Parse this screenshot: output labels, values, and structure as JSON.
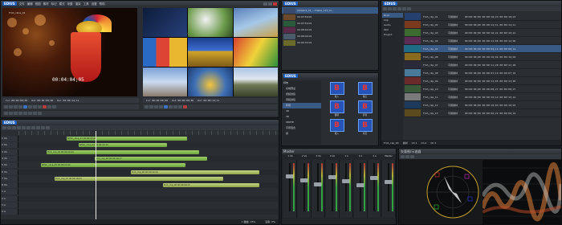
{
  "app": {
    "name": "EDIUS",
    "brand": "#1e5fbf"
  },
  "player": {
    "menu": [
      "文件",
      "编辑",
      "视图",
      "素材",
      "标记",
      "模式",
      "采集",
      "渲染",
      "工具",
      "设置",
      "帮助"
    ],
    "clip_name": "Fmh_cline_01",
    "timecode_overlay": "00:04:04;05",
    "tc_row": [
      "Cur 00:00:00;00",
      "Out 00:00:00;00",
      "Dur 00:00:14;11"
    ]
  },
  "recorder": {
    "tc_row": [
      "Cur 00:00:00;00",
      "Out 00:00:00;00",
      "Dur 00:00:14;11"
    ]
  },
  "bin_top": {
    "rows": [
      "(0)Nab3_01_...Vlabla_123_ld...",
      "00:03:59:05",
      "00:03:59:09",
      "00:08:44:09",
      "00:08:04:09",
      "00:00:32:09"
    ]
  },
  "asset": {
    "title": "EDIUS",
    "tree": [
      "特效",
      "系统预设",
      "视频滤镜",
      "音频滤镜",
      "转场",
      "2D",
      "3D",
      "SMPTE",
      "字幕混合",
      "键"
    ],
    "icons": [
      "推入",
      "推出",
      "翻转",
      "折叠",
      "推入",
      "卷页"
    ]
  },
  "bin_right": {
    "title": "EDIUS",
    "folders": [
      "Root",
      "Clip",
      "Audio",
      "Still",
      "Project"
    ],
    "rows": [
      {
        "name": "Fmh_clip_01",
        "status": "可用素材",
        "tc": "00:00:00;00 00:00:18;23 00:00:18;23"
      },
      {
        "name": "Fmh_clip_02",
        "status": "可用素材",
        "tc": "00:00:00;00 00:00:14;11 00:00:14;11"
      },
      {
        "name": "Fmh_clip_03",
        "status": "可用素材",
        "tc": "00:00:00;00 00:00:10;21 00:00:10;21"
      },
      {
        "name": "Fmh_clip_04",
        "status": "可用素材",
        "tc": "00:00:00;00 00:00:12;06 00:00:12;06"
      },
      {
        "name": "Fmh_clip_05",
        "status": "可用素材",
        "tc": "00:00:00;00 00:00:09;14 00:00:09;14"
      },
      {
        "name": "Fmh_clip_06",
        "status": "可用素材",
        "tc": "00:00:00;00 00:00:16;02 00:00:16;02"
      },
      {
        "name": "Fmh_clip_07",
        "status": "可用素材",
        "tc": "00:00:00;00 00:00:11;28 00:00:11;28"
      },
      {
        "name": "Fmh_clip_08",
        "status": "可用素材",
        "tc": "00:00:00;00 00:00:07;19 00:00:07;19"
      },
      {
        "name": "Fmh_clip_09",
        "status": "可用素材",
        "tc": "00:00:00;00 00:00:13;05 00:00:13;05"
      },
      {
        "name": "Fmh_clip_10",
        "status": "可用素材",
        "tc": "00:00:00;00 00:00:08;27 00:00:08;27"
      },
      {
        "name": "Fmh_clip_11",
        "status": "可用素材",
        "tc": "00:00:00;00 00:00:15;12 00:00:15;12"
      },
      {
        "name": "Fmh_clip_12",
        "status": "可用素材",
        "tc": "00:00:00;00 00:00:10;03 00:00:10;03"
      },
      {
        "name": "Fmh_clip_13",
        "status": "可用素材",
        "tc": "00:00:00;00 00:00:06;22 00:00:06;22"
      }
    ],
    "footer": [
      "Fmh_clip_03",
      "素材",
      "Ch 1",
      "Ch 2",
      "Ch 3"
    ]
  },
  "timeline": {
    "title": "EDIUS",
    "tracks": [
      "1 VA",
      "2 VA",
      "3 VA",
      "4 VA",
      "5 VA",
      "6 VA",
      "7 VA",
      "8 VA",
      "1 A",
      "2 A",
      "3 A",
      "4 A"
    ],
    "clips": [
      {
        "label": "NTSC_cline_01 00:00:15;00",
        "type": "v"
      },
      {
        "label": "NTSC_cline_02 00:00:10;14",
        "type": "v"
      },
      {
        "label": "Fmh_clip_03 00:00:22;09",
        "type": "v"
      },
      {
        "label": "Fmh_clip_04 00:00:19;17",
        "type": "v"
      },
      {
        "label": "NTSC_cline_05 00:00:21;02",
        "type": "v"
      },
      {
        "label": "Fmh_clip_06 00:00:12;24",
        "type": "a"
      },
      {
        "label": "Fmh_clip_07 00:00:18;03",
        "type": "a"
      },
      {
        "label": "Fmh_clip_08 00:00:09;15",
        "type": "a"
      }
    ],
    "status": [
      "1 磁盘: 15%",
      "渲染: 0%"
    ]
  },
  "mixer": {
    "title": "Master",
    "channels": [
      "1 VA",
      "2 VA",
      "3 VA",
      "4 VA",
      "1 A",
      "2 A",
      "3 A",
      "Master"
    ]
  },
  "scope": {
    "title": "矢量图/示波器"
  }
}
